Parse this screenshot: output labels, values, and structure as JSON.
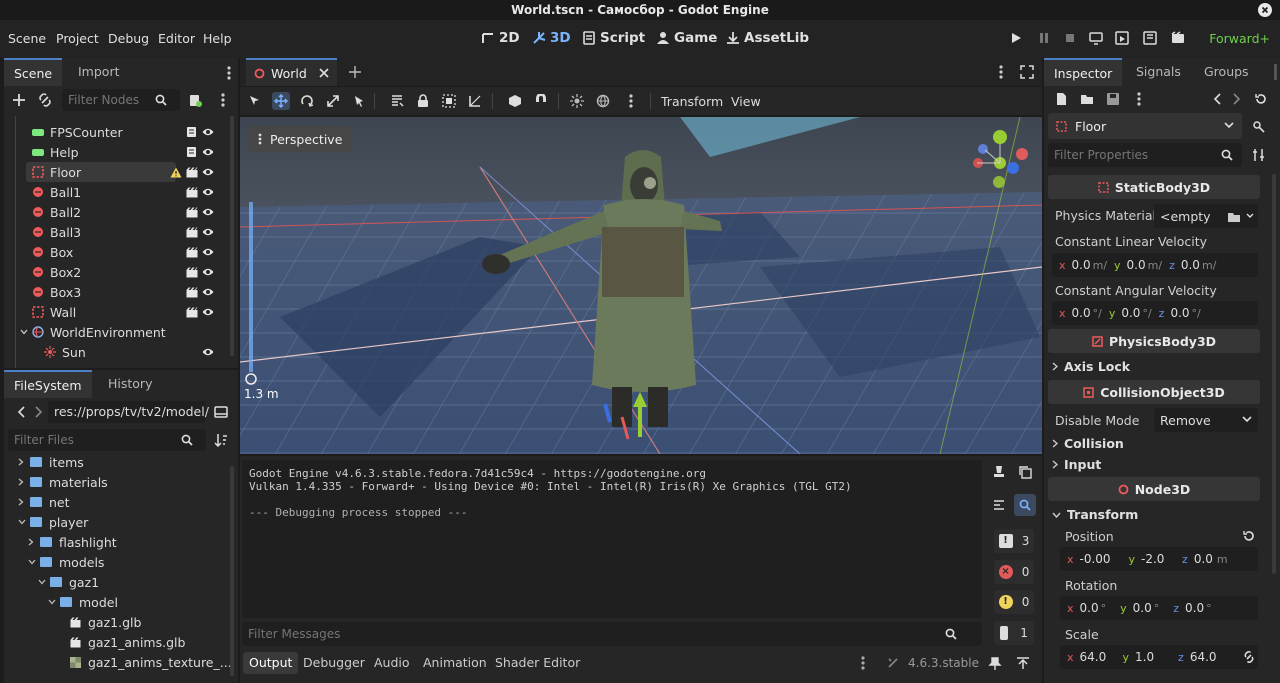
{
  "window": {
    "title": "World.tscn - Самосбор - Godot Engine"
  },
  "menu": [
    "Scene",
    "Project",
    "Debug",
    "Editor",
    "Help"
  ],
  "modes": [
    {
      "label": "2D",
      "active": false
    },
    {
      "label": "3D",
      "active": true
    },
    {
      "label": "Script",
      "active": false
    },
    {
      "label": "Game",
      "active": false
    },
    {
      "label": "AssetLib",
      "active": false
    }
  ],
  "renderer": "Forward+",
  "scene_dock": {
    "tabs": [
      "Scene",
      "Import"
    ],
    "filter_placeholder": "Filter Nodes",
    "nodes": [
      {
        "name": "FPSCounter",
        "icon": "control-icon",
        "color": "#7de87d"
      },
      {
        "name": "Help",
        "icon": "control-icon",
        "color": "#7de87d"
      },
      {
        "name": "Floor",
        "icon": "static-body-icon",
        "color": "#f05a5a",
        "selected": true,
        "warning": true
      },
      {
        "name": "Ball1",
        "icon": "rigid-body-icon",
        "color": "#f05a5a"
      },
      {
        "name": "Ball2",
        "icon": "rigid-body-icon",
        "color": "#f05a5a"
      },
      {
        "name": "Ball3",
        "icon": "rigid-body-icon",
        "color": "#f05a5a"
      },
      {
        "name": "Box",
        "icon": "rigid-body-icon",
        "color": "#f05a5a"
      },
      {
        "name": "Box2",
        "icon": "rigid-body-icon",
        "color": "#f05a5a"
      },
      {
        "name": "Box3",
        "icon": "rigid-body-icon",
        "color": "#f05a5a"
      },
      {
        "name": "Wall",
        "icon": "static-body-icon",
        "color": "#f05a5a"
      },
      {
        "name": "WorldEnvironment",
        "icon": "world-environment-icon",
        "color": "#f05a5a"
      },
      {
        "name": "Sun",
        "icon": "directional-light-icon",
        "color": "#f05a5a"
      }
    ]
  },
  "filesystem": {
    "tabs": [
      "FileSystem",
      "History"
    ],
    "path": "res://props/tv/tv2/model/",
    "filter_placeholder": "Filter Files",
    "items": [
      {
        "name": "items",
        "type": "folder"
      },
      {
        "name": "materials",
        "type": "folder"
      },
      {
        "name": "net",
        "type": "folder"
      },
      {
        "name": "player",
        "type": "folder",
        "open": true
      },
      {
        "name": "flashlight",
        "type": "folder"
      },
      {
        "name": "models",
        "type": "folder",
        "open": true
      },
      {
        "name": "gaz1",
        "type": "folder",
        "open": true
      },
      {
        "name": "model",
        "type": "folder",
        "open": true
      },
      {
        "name": "gaz1.glb",
        "type": "scene"
      },
      {
        "name": "gaz1_anims.glb",
        "type": "scene"
      },
      {
        "name": "gaz1_anims_texture_...",
        "type": "texture"
      }
    ]
  },
  "editor_tab": {
    "label": "World"
  },
  "viewport_toolbar": {
    "transform": "Transform",
    "view": "View"
  },
  "viewport": {
    "perspective": "Perspective",
    "zoom_label": "1.3 m"
  },
  "output": {
    "lines": [
      "Godot Engine v4.6.3.stable.fedora.7d41c59c4 - https://godotengine.org",
      "Vulkan 1.4.335 - Forward+ - Using Device #0: Intel - Intel(R) Iris(R) Xe Graphics (TGL GT2)",
      "",
      "--- Debugging process stopped ---"
    ],
    "filter_placeholder": "Filter Messages",
    "counts": {
      "messages": "3",
      "errors": "0",
      "warnings": "0",
      "editor": "1"
    }
  },
  "bottom_tabs": [
    "Output",
    "Debugger",
    "Audio",
    "Animation",
    "Shader Editor"
  ],
  "version": "4.6.3.stable",
  "inspector": {
    "tabs": [
      "Inspector",
      "Signals",
      "Groups"
    ],
    "node_name": "Floor",
    "filter_placeholder": "Filter Properties",
    "static_body": "StaticBody3D",
    "physics_material_label": "Physics Material",
    "physics_material_value": "<empty",
    "linear_velocity_label": "Constant Linear Velocity",
    "linear_velocity": {
      "x": "0.0",
      "y": "0.0",
      "z": "0.0",
      "unit": "m/"
    },
    "angular_velocity_label": "Constant Angular Velocity",
    "angular_velocity": {
      "x": "0.0",
      "y": "0.0",
      "z": "0.0",
      "unit": "°/"
    },
    "physics_body": "PhysicsBody3D",
    "axis_lock": "Axis Lock",
    "collision_object": "CollisionObject3D",
    "disable_mode_label": "Disable Mode",
    "disable_mode_value": "Remove",
    "collision": "Collision",
    "input": "Input",
    "node3d": "Node3D",
    "transform": "Transform",
    "position_label": "Position",
    "position": {
      "x": "-0.00",
      "y": "-2.0",
      "z": "0.0",
      "unit": "m"
    },
    "rotation_label": "Rotation",
    "rotation": {
      "x": "0.0",
      "y": "0.0",
      "z": "0.0",
      "unit": "°"
    },
    "scale_label": "Scale",
    "scale": {
      "x": "64.0",
      "y": "1.0",
      "z": "64.0"
    }
  }
}
